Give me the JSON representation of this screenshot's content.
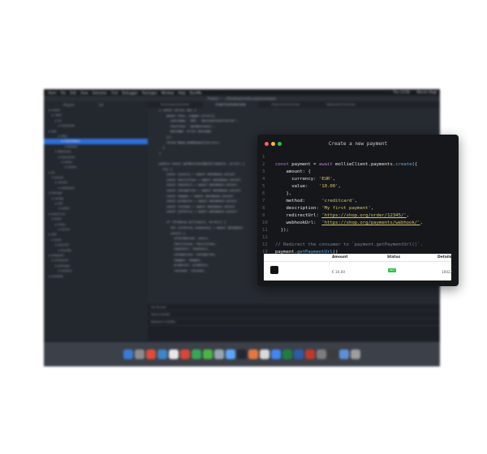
{
  "background": {
    "menubar": {
      "items": [
        "Atom",
        "File",
        "Edit",
        "View",
        "Selection",
        "Find",
        "Debugger",
        "Packages",
        "Window",
        "Help",
        "Run/Me"
      ],
      "right_items": [
        "Thu 13:58",
        "Marvin Degt"
      ]
    },
    "window_title": "Project — ~/Desktop/mollie-php/examples",
    "sidebar_headers": [
      "Project",
      "Git"
    ],
    "tree": [
      "mollie",
      ".idea",
      "src",
      "examples",
      "app",
      "Http",
      "Controllers",
      "Models",
      "Webhook",
      "Payments",
      "views",
      "routes",
      "lib",
      "assets",
      "vendor",
      "database",
      "storage",
      "config",
      "dist",
      "public",
      "resources",
      "tests",
      "index",
      "server",
      "pkg",
      "tests",
      "phpunit",
      "Procfile",
      "webpack",
      "composer",
      "package",
      "readme",
      "LICENSE"
    ],
    "tabs": [
      "BusinessController",
      "OrderController.php",
      "PaymentController",
      "WebhookController"
    ],
    "code_lines": [
      "} catch (Error $e) {",
      "    await this._logger.error({",
      "      username: 'API - BusinessController',",
      "      function: 'getBusiness',",
      "      message: error.message",
      "    });",
      "    throw Boom.badRequest(error);",
      "  }",
      "}",
      "",
      "public async getBusinessById(request, error) {",
      "  try {",
      "    const [users] = await database.select",
      "    const facilities = await database.select",
      "    const teachers = await database.select",
      "    const categories = await database.select",
      "    const images = await database.select",
      "    const products = await database.select",
      "    const reviews = await database.select",
      "    const [offers] = await database.select",
      "",
      "    if (Promise.all(users, error)) {",
      "      let [inforce_response] = await database",
      "      return {",
      "        information: users,",
      "        facilities: facilities,",
      "        teachers: teachers,",
      "        categories: categories,",
      "        images: images,",
      "        products: products,",
      "        reviews: reviews,"
    ],
    "panel_lines": [
      "Go To Line",
      "Find in Buffer",
      "Replace in Buffer"
    ]
  },
  "card": {
    "title": "Create a new payment",
    "lines": [
      {
        "n": "1",
        "tokens": []
      },
      {
        "n": "2",
        "tokens": [
          [
            "kw",
            "const "
          ],
          [
            "key",
            "payment "
          ],
          [
            "pun",
            "= "
          ],
          [
            "kw",
            "await "
          ],
          [
            "key",
            "mollieClient"
          ],
          [
            "pun",
            "."
          ],
          [
            "key",
            "payments"
          ],
          [
            "pun",
            "."
          ],
          [
            "fn",
            "create"
          ],
          [
            "pun",
            "({"
          ]
        ]
      },
      {
        "n": "3",
        "tokens": [
          [
            "pun",
            "    "
          ],
          [
            "key",
            "amount"
          ],
          [
            "pun",
            ": {"
          ]
        ]
      },
      {
        "n": "4",
        "tokens": [
          [
            "pun",
            "      "
          ],
          [
            "key",
            "currency"
          ],
          [
            "pun",
            ": "
          ],
          [
            "str",
            "'EUR'"
          ],
          [
            "pun",
            ","
          ]
        ]
      },
      {
        "n": "5",
        "tokens": [
          [
            "pun",
            "      "
          ],
          [
            "key",
            "value"
          ],
          [
            "pun",
            ":    "
          ],
          [
            "str",
            "'10.00'"
          ],
          [
            "pun",
            ","
          ]
        ]
      },
      {
        "n": "6",
        "tokens": [
          [
            "pun",
            "    },"
          ]
        ]
      },
      {
        "n": "7",
        "tokens": [
          [
            "pun",
            "    "
          ],
          [
            "key",
            "method"
          ],
          [
            "pun",
            ":      "
          ],
          [
            "str",
            "'creditcard'"
          ],
          [
            "pun",
            ","
          ]
        ]
      },
      {
        "n": "8",
        "tokens": [
          [
            "pun",
            "    "
          ],
          [
            "key",
            "description"
          ],
          [
            "pun",
            ": "
          ],
          [
            "str",
            "'My first payment'"
          ],
          [
            "pun",
            ","
          ]
        ]
      },
      {
        "n": "9",
        "tokens": [
          [
            "pun",
            "    "
          ],
          [
            "key",
            "redirectUrl"
          ],
          [
            "pun",
            ": "
          ],
          [
            "url",
            "'https://shop.org/order/12345/'"
          ],
          [
            "pun",
            ","
          ]
        ]
      },
      {
        "n": "10",
        "tokens": [
          [
            "pun",
            "    "
          ],
          [
            "key",
            "webhookUrl"
          ],
          [
            "pun",
            ":  "
          ],
          [
            "url",
            "'https://shop.org/payments/webhook/'"
          ],
          [
            "pun",
            ","
          ]
        ]
      },
      {
        "n": "11",
        "tokens": [
          [
            "pun",
            "  });"
          ]
        ]
      },
      {
        "n": "12",
        "tokens": []
      },
      {
        "n": "12",
        "tokens": [
          [
            "com",
            "// Redirect the consumer to `payment.getPaymentUrl()`."
          ]
        ]
      },
      {
        "n": "13",
        "tokens": [
          [
            "key",
            "payment"
          ],
          [
            "pun",
            "."
          ],
          [
            "fn",
            "getPaymentUrl"
          ],
          [
            "pun",
            "()"
          ]
        ]
      }
    ],
    "table": {
      "headers": [
        "Amount",
        "Status",
        "Details"
      ],
      "row": {
        "amount": "€ 10,00",
        "status": "Paid",
        "details": "10022"
      }
    }
  },
  "colors": {
    "dot_red": "#ff5f57",
    "dot_yellow": "#febc2e",
    "dot_green": "#28c840",
    "status_paid": "#2fbf4a"
  },
  "dock_icons": [
    "#3a7bd5",
    "#8c8c8c",
    "#e04b3a",
    "#3d85c6",
    "#e8e8e8",
    "#d9443b",
    "#3aa655",
    "#4bb543",
    "#9aa4ae",
    "#58a6ff",
    "#222831",
    "#e6783b",
    "#d9d9d9",
    "#4285f4",
    "#1e7d45",
    "#2a5caa",
    "#c0392b",
    "#7d7d7d",
    "#3c3c3c",
    "#5f8fd6",
    "#9e9e9e"
  ]
}
